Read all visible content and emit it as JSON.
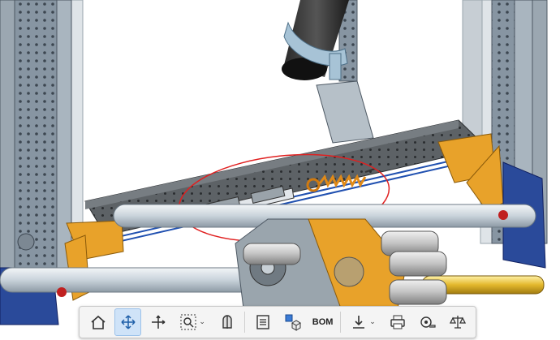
{
  "scene": {
    "description_name": "cad-assembly-viewport"
  },
  "toolbar": {
    "buttons": [
      {
        "name": "home-view",
        "icon": "home-icon"
      },
      {
        "name": "view-manipulator",
        "icon": "move-arrows-icon",
        "active": true
      },
      {
        "name": "triad",
        "icon": "axis-triad-icon"
      },
      {
        "name": "zoom-window",
        "icon": "zoom-box-icon",
        "has_dropdown": true
      },
      {
        "name": "section-view",
        "icon": "section-cut-icon"
      },
      {
        "name": "parts-list",
        "icon": "list-icon"
      },
      {
        "name": "exploded-view",
        "icon": "explode-cube-icon"
      },
      {
        "name": "bom",
        "icon": "bom-icon"
      },
      {
        "name": "export",
        "icon": "download-icon",
        "has_dropdown": true
      },
      {
        "name": "print",
        "icon": "printer-icon"
      },
      {
        "name": "measure",
        "icon": "tape-measure-icon"
      },
      {
        "name": "mass-properties",
        "icon": "balance-scale-icon"
      }
    ],
    "bom_label": "BOM"
  },
  "colors": {
    "frame_metal": "#8a9aa8",
    "plate_dark": "#5f6468",
    "gusset_orange": "#e8a22a",
    "base_blue": "#2a4a9a",
    "annotation_red": "#e02020",
    "cable_blue": "#2050b0"
  }
}
